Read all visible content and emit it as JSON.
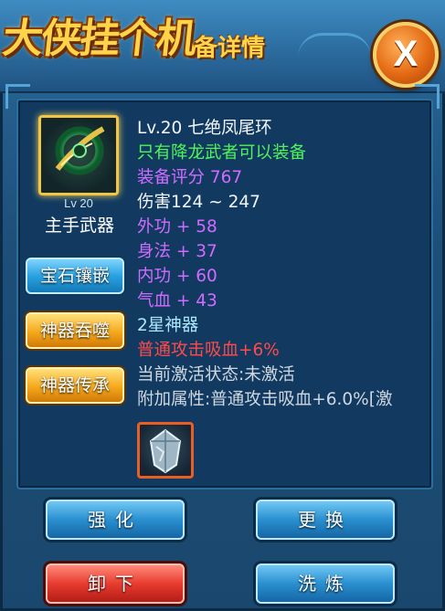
{
  "header": {
    "game_logo": "大侠挂个机",
    "title_suffix": "备详情",
    "close_label": "X"
  },
  "item": {
    "level_badge": "Lv 20",
    "slot_label": "主手武器",
    "icon": "jade-ring-blade-icon"
  },
  "side_buttons": {
    "gem_inlay": "宝石镶嵌",
    "artifact_devour": "神器吞噬",
    "artifact_inherit": "神器传承"
  },
  "details": {
    "name_line": "Lv.20  七绝凤尾环",
    "requirement": "只有降龙武者可以装备",
    "score": "装备评分 767",
    "damage": "伤害124 ~ 247",
    "stat_1": "外功  + 58",
    "stat_2": "身法  + 37",
    "stat_3": "内功  + 60",
    "stat_4": "气血  + 43",
    "artifact_star": "2星神器",
    "artifact_effect": "普通攻击吸血+6%",
    "activation": "当前激活状态:未激活",
    "extra_attr": "附加属性:普通攻击吸血+6.0%[激"
  },
  "bottom_buttons": {
    "enhance": "强化",
    "replace": "更换",
    "unequip": "卸下",
    "refine": "洗炼"
  },
  "colors": {
    "green": "#4ef45a",
    "purple": "#d06bff",
    "red": "#ff4a4a",
    "gold": "#f2c640"
  }
}
